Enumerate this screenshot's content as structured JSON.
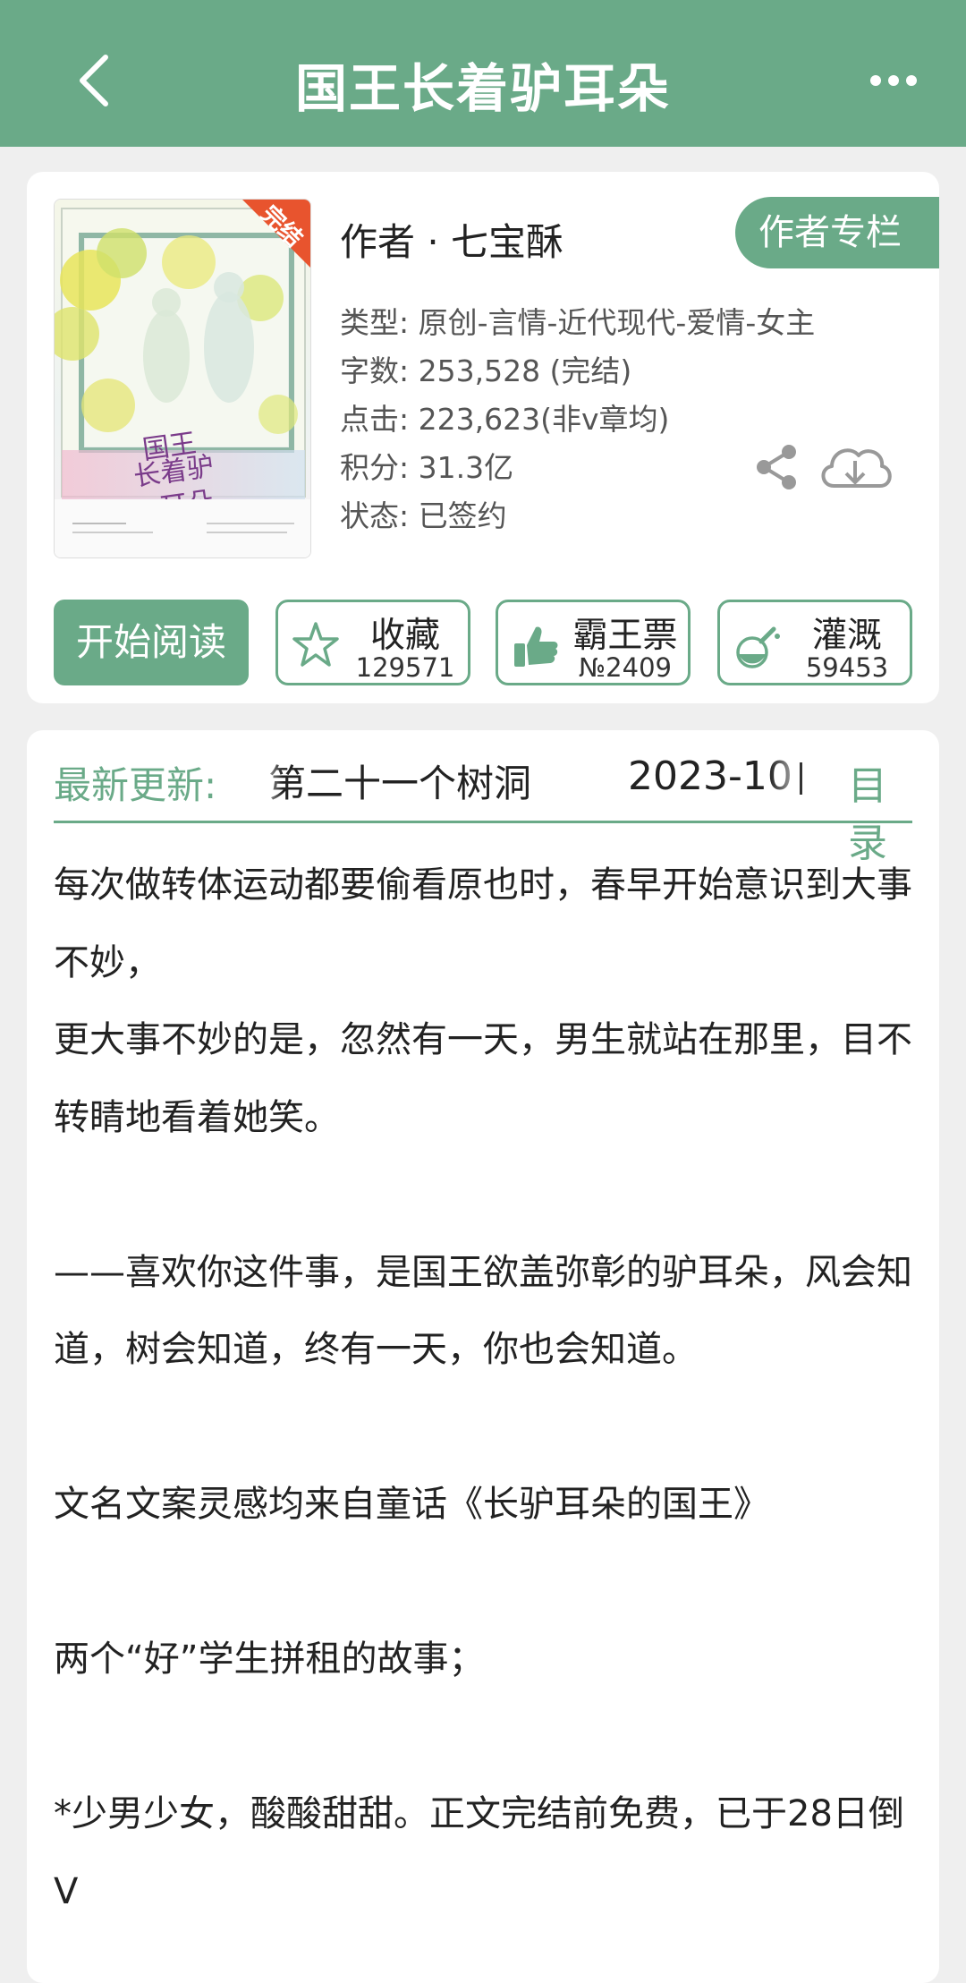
{
  "header": {
    "title": "国王长着驴耳朵"
  },
  "book": {
    "badge": "完结",
    "cover_text": "国王长着驴耳朵",
    "author_line": "作者 · 七宝酥",
    "author_column_label": "作者专栏",
    "meta": [
      "类型: 原创-言情-近代现代-爱情-女主",
      "字数: 253,528 (完结)",
      "点击: 223,623(非v章均)",
      "积分: 31.3亿",
      "状态: 已签约"
    ]
  },
  "actions": {
    "read_label": "开始阅读",
    "buttons": [
      {
        "label": "收藏",
        "count": "129571",
        "icon": "star-icon"
      },
      {
        "label": "霸王票",
        "count": "№2409",
        "icon": "thumbs-up-icon"
      },
      {
        "label": "灌溉",
        "count": "59453",
        "icon": "nutrient-flask-icon"
      }
    ]
  },
  "update": {
    "label": "最新更新:",
    "chapter": "第二十一个树洞",
    "date": "2023-10",
    "toc_label": "目录"
  },
  "description": [
    "每次做转体运动都要偷看原也时，春早开始意识到大事不妙，",
    "更大事不妙的是，忽然有一天，男生就站在那里，目不转睛地看着她笑。",
    "",
    "——喜欢你这件事，是国王欲盖弥彰的驴耳朵，风会知道，树会知道，终有一天，你也会知道。",
    "",
    "文名文案灵感均来自童话《长驴耳朵的国王》",
    "",
    "两个“好”学生拼租的故事；",
    "",
    "*少男少女，酸酸甜甜。正文完结前免费，已于28日倒V"
  ],
  "colors": {
    "accent": "#6aaa88",
    "header_bg": "#6aaa88",
    "badge": "#e8542e"
  }
}
